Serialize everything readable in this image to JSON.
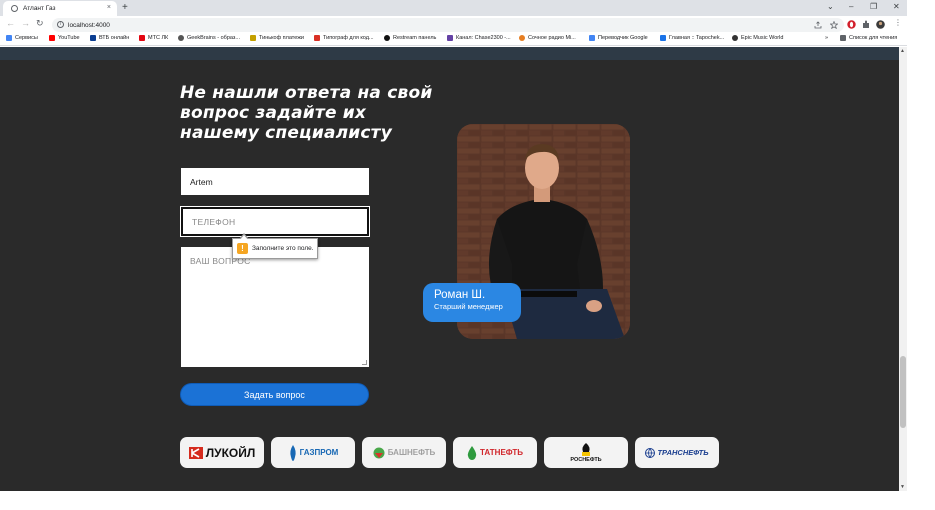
{
  "browser": {
    "tab_title": "Атлант Газ",
    "tab_close": "×",
    "new_tab": "+",
    "window_controls": {
      "collapse": "⌄",
      "minimize": "–",
      "restore": "❐",
      "close": "✕"
    },
    "nav": {
      "back": "←",
      "forward": "→",
      "reload": "↻"
    },
    "url": "localhost:4000",
    "bookmarks": [
      {
        "label": "Сервисы",
        "color": "#4285f4"
      },
      {
        "label": "YouTube",
        "color": "#ff0000"
      },
      {
        "label": "ВТБ онлайн",
        "color": "#0a3d91"
      },
      {
        "label": "МТС ЛК",
        "color": "#e30611"
      },
      {
        "label": "GeekBrains - образ...",
        "color": "#555555"
      },
      {
        "label": "Тинькоф платежи",
        "color": "#c4a000"
      },
      {
        "label": "Типограф для код...",
        "color": "#d93025"
      },
      {
        "label": "Restream панель",
        "color": "#111111"
      },
      {
        "label": "Канал: Chase2300 -...",
        "color": "#6441a5"
      },
      {
        "label": "Сочное радио Mi...",
        "color": "#e67e22"
      },
      {
        "label": "Переводчик Google",
        "color": "#4285f4"
      },
      {
        "label": "Главная :: Tapochek...",
        "color": "#1a73e8"
      },
      {
        "label": "Epic Music World",
        "color": "#333333"
      }
    ],
    "bookmarks_more": "»",
    "reading_list": "Список для чтения"
  },
  "form": {
    "heading": "Не нашли ответа на свой вопрос задайте их нашему специалисту",
    "name_value": "Artem",
    "phone_placeholder": "ТЕЛЕФОН",
    "question_placeholder": "ВАШ ВОПРОС",
    "validation_message": "Заполните это поле.",
    "submit_label": "Задать вопрос"
  },
  "specialist": {
    "name": "Роман Ш.",
    "role": "Старший менеджер"
  },
  "partners": [
    "ЛУКОЙЛ",
    "ГАЗПРОМ",
    "БАШНЕФТЬ",
    "ТАТНЕФТЬ",
    "РОСНЕФТЬ",
    "ТРАНСНЕФТЬ"
  ],
  "colors": {
    "page_background": "#2a2a2a",
    "accent_blue": "#1b72d6",
    "badge_blue": "#2b87e3"
  }
}
